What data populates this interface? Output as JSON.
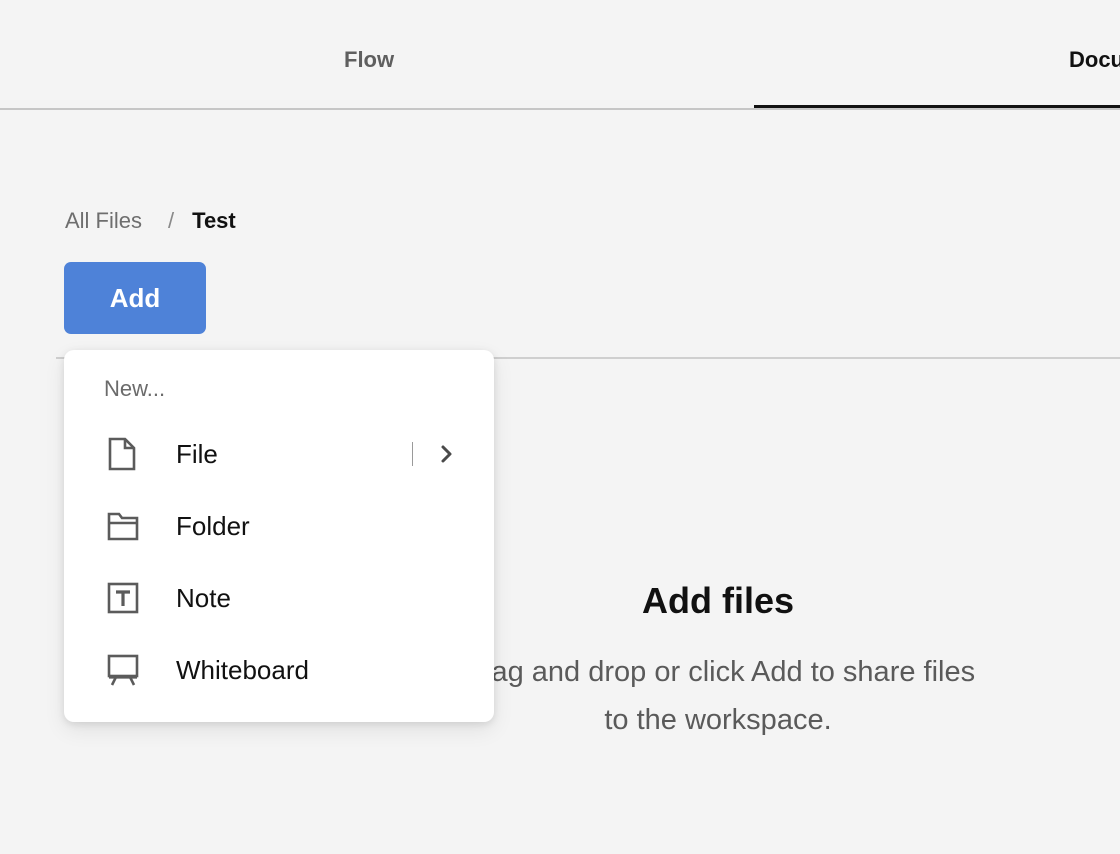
{
  "tabs": [
    {
      "label": "Flow",
      "active": false
    },
    {
      "label": "Documents",
      "active": true
    }
  ],
  "breadcrumb": {
    "root": "All Files",
    "separator": "/",
    "current": "Test"
  },
  "add_button": {
    "label": "Add"
  },
  "menu": {
    "heading": "New...",
    "items": [
      {
        "label": "File",
        "icon": "file-icon",
        "has_submenu": true
      },
      {
        "label": "Folder",
        "icon": "folder-icon"
      },
      {
        "label": "Note",
        "icon": "note-icon"
      },
      {
        "label": "Whiteboard",
        "icon": "whiteboard-icon"
      }
    ]
  },
  "empty_state": {
    "title": "Add files",
    "description_line1": "Drag and drop or click Add to share files",
    "description_line2": "to the workspace."
  },
  "colors": {
    "background": "#f4f4f4",
    "accent": "#4e82d8",
    "active_tab_underline": "#111111"
  }
}
